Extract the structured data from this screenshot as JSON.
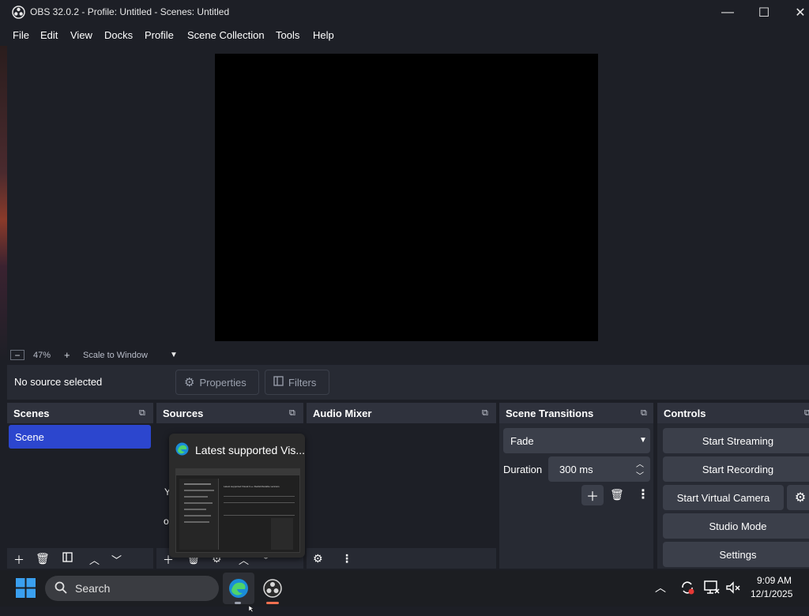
{
  "window": {
    "title": "OBS 32.0.2 - Profile: Untitled - Scenes: Untitled",
    "minimize": "—",
    "maximize": "☐",
    "close": "✕"
  },
  "menu": [
    "File",
    "Edit",
    "View",
    "Docks",
    "Profile",
    "Scene Collection",
    "Tools",
    "Help"
  ],
  "zoom": {
    "minus": "−",
    "value": "47%",
    "plus": "+",
    "mode": "Scale to Window"
  },
  "context": {
    "status": "No source selected",
    "properties": "Properties",
    "filters": "Filters"
  },
  "scenes": {
    "title": "Scenes",
    "items": [
      "Scene"
    ]
  },
  "sources": {
    "title": "Sources",
    "partial_text_1": "Y",
    "partial_text_2": "o"
  },
  "thumbnail": {
    "title": "Latest supported Vis...",
    "inner_heading": "Latest supported Visual C++ Redistributable versions"
  },
  "audio_mixer": {
    "title": "Audio Mixer"
  },
  "transitions": {
    "title": "Scene Transitions",
    "selected": "Fade",
    "duration_label": "Duration",
    "duration_value": "300 ms"
  },
  "controls": {
    "title": "Controls",
    "start_streaming": "Start Streaming",
    "start_recording": "Start Recording",
    "start_virtual_camera": "Start Virtual Camera",
    "studio_mode": "Studio Mode",
    "settings": "Settings"
  },
  "taskbar": {
    "search": "Search",
    "time": "9:09 AM",
    "date": "12/1/2025"
  },
  "colors": {
    "background": "#1d1f26",
    "panel": "#272a33",
    "header": "#2f323d",
    "button": "#3b3f4a",
    "selection": "#2c46ce",
    "taskbar": "#1c1e22"
  }
}
